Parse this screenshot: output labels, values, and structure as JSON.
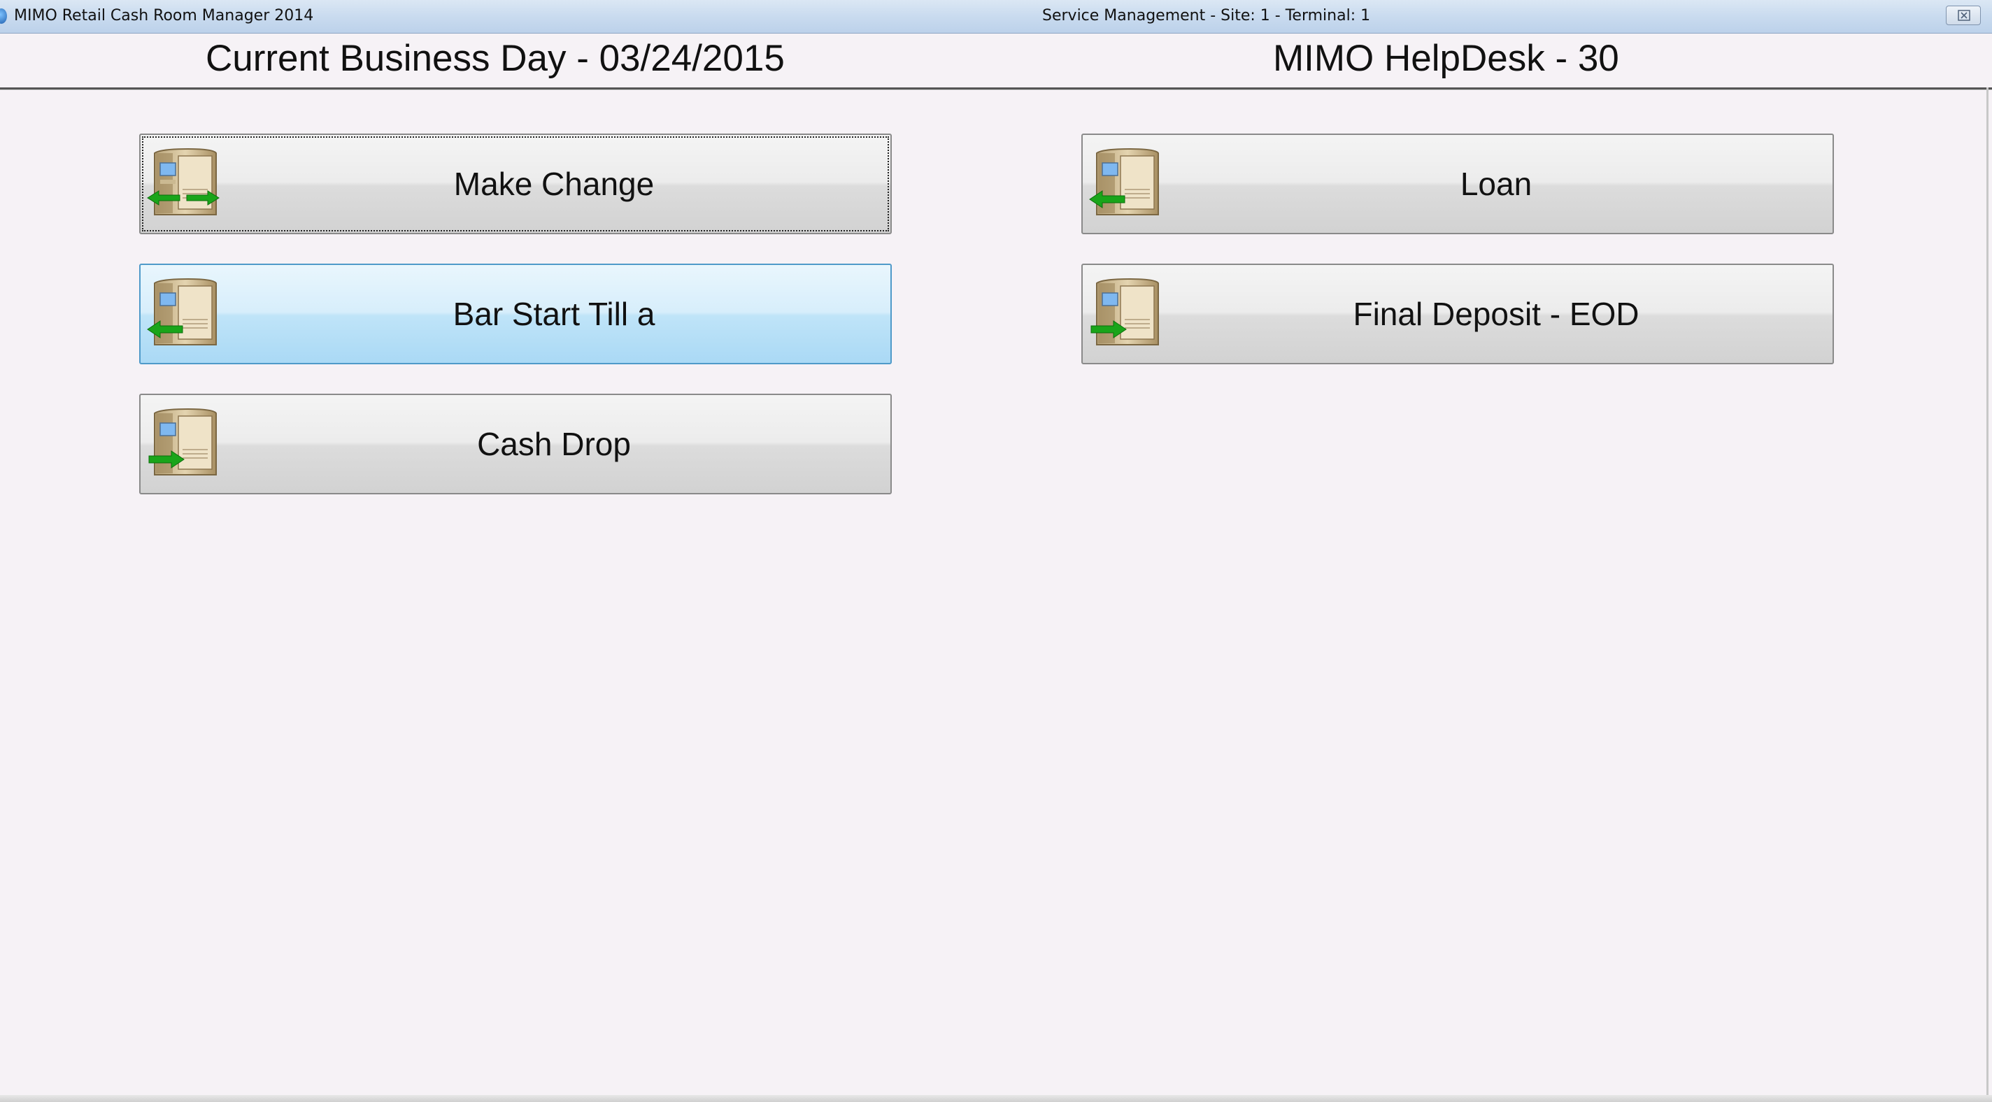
{
  "window": {
    "app_title": "MIMO Retail Cash Room Manager 2014",
    "caption": "Service Management - Site: 1 - Terminal: 1",
    "close_icon": "close-icon"
  },
  "header": {
    "business_day": "Current Business Day - 03/24/2015",
    "helpdesk": "MIMO HelpDesk - 30"
  },
  "actions": {
    "make_change": {
      "label": "Make Change",
      "icon": "atm-exchange-icon"
    },
    "loan": {
      "label": "Loan",
      "icon": "atm-withdraw-icon"
    },
    "bar_start_till": {
      "label": "Bar Start Till a",
      "icon": "atm-withdraw-icon"
    },
    "final_deposit": {
      "label": "Final Deposit - EOD",
      "icon": "atm-deposit-icon"
    },
    "cash_drop": {
      "label": "Cash Drop",
      "icon": "atm-deposit-icon"
    }
  },
  "colors": {
    "background": "#f6f2f6",
    "button_hover": "#bfe4f8",
    "arrow_green": "#1aa51a"
  }
}
